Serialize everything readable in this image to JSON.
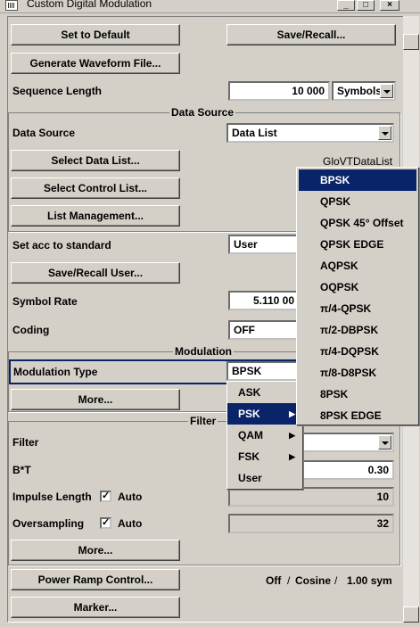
{
  "window": {
    "title": "Custom Digital Modulation",
    "min_icon": "_",
    "max_icon": "□",
    "close_icon": "×"
  },
  "top": {
    "set_to_default": "Set to Default",
    "save_recall": "Save/Recall...",
    "generate_waveform": "Generate Waveform File..."
  },
  "sequence_length": {
    "label": "Sequence Length",
    "value": "10 000",
    "unit": "Symbols"
  },
  "data_source_group": {
    "title": "Data Source",
    "data_source_label": "Data Source",
    "data_source_value": "Data List",
    "select_data_list": "Select Data List...",
    "selected_list_name": "GloVTDataList",
    "select_control_list": "Select Control List...",
    "list_management": "List Management..."
  },
  "standard": {
    "label": "Set acc to standard",
    "value": "User",
    "save_recall_user": "Save/Recall User..."
  },
  "symbol_rate": {
    "label": "Symbol Rate",
    "value": "5.110 00"
  },
  "coding": {
    "label": "Coding",
    "value": "OFF"
  },
  "modulation_group": {
    "title": "Modulation",
    "type_label": "Modulation Type",
    "type_value": "BPSK",
    "more": "More..."
  },
  "filter_group": {
    "title": "Filter",
    "filter_label": "Filter",
    "bt_label": "B*T",
    "bt_value": "0.30",
    "impulse_length_label": "Impulse Length",
    "impulse_auto": "Auto",
    "impulse_value": "10",
    "oversampling_label": "Oversampling",
    "oversampling_auto": "Auto",
    "oversampling_value": "32",
    "more": "More..."
  },
  "power_ramp": {
    "button": "Power Ramp Control...",
    "state": "Off",
    "sep1": "/",
    "shape": "Cosine",
    "sep2": "/",
    "length": "1.00 sym"
  },
  "marker": {
    "button": "Marker..."
  },
  "mod_category_menu": {
    "items": [
      "ASK",
      "PSK",
      "QAM",
      "FSK",
      "User"
    ],
    "selected": "PSK"
  },
  "psk_submenu": {
    "items": [
      "BPSK",
      "QPSK",
      "QPSK 45° Offset",
      "QPSK EDGE",
      "AQPSK",
      "OQPSK",
      "π/4-QPSK",
      "π/2-DBPSK",
      "π/4-DQPSK",
      "π/8-D8PSK",
      "8PSK",
      "8PSK EDGE"
    ],
    "selected": "BPSK"
  },
  "colors": {
    "face": "#d4d0c8",
    "highlight": "#0a246a"
  }
}
